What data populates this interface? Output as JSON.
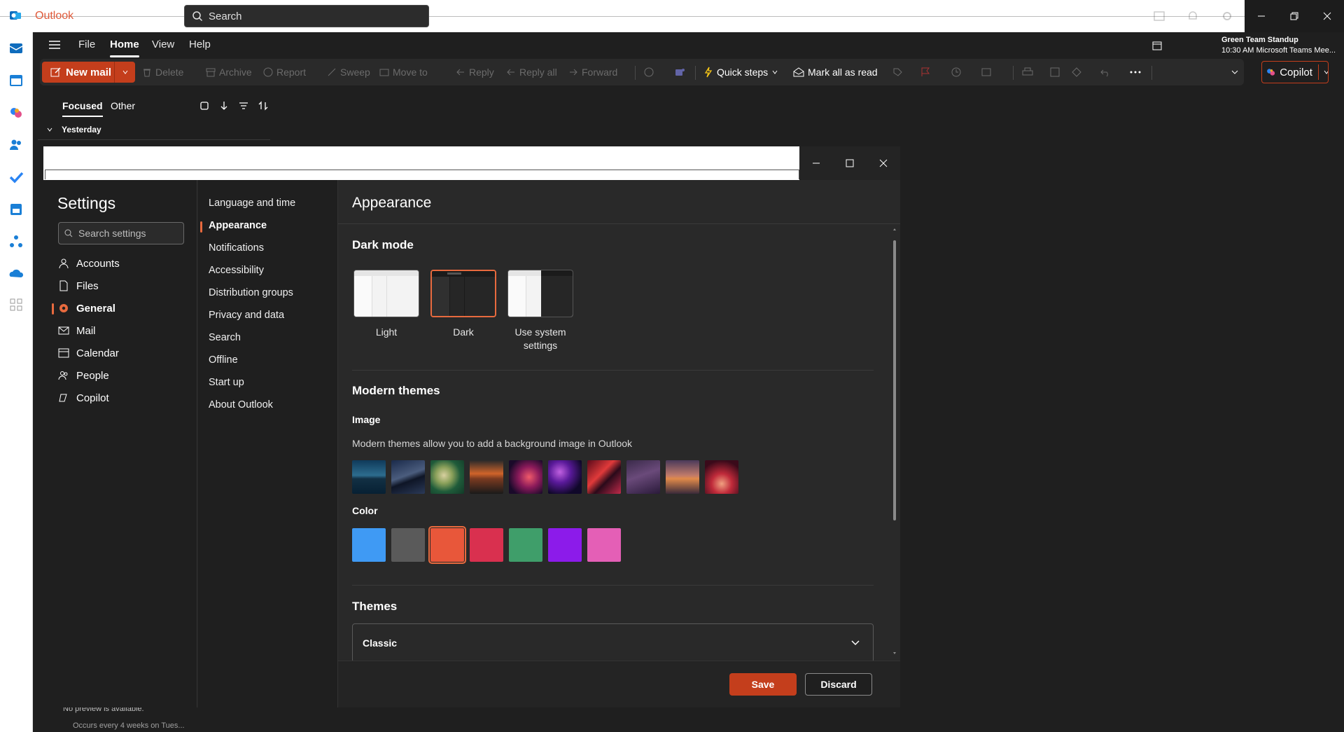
{
  "app": {
    "name": "Outlook"
  },
  "titlebar": {
    "search_placeholder": "Search"
  },
  "menu": {
    "items": [
      "File",
      "Home",
      "View",
      "Help"
    ],
    "active": "Home"
  },
  "meeting": {
    "title": "Green Team Standup",
    "detail": "10:30 AM Microsoft Teams Mee..."
  },
  "toolbar": {
    "new_mail": "New mail",
    "delete": "Delete",
    "archive": "Archive",
    "report": "Report",
    "sweep": "Sweep",
    "move_to": "Move to",
    "reply": "Reply",
    "reply_all": "Reply all",
    "forward": "Forward",
    "quick_steps": "Quick steps",
    "mark_all_read": "Mark all as read",
    "copilot": "Copilot"
  },
  "mail_list": {
    "tab_focused": "Focused",
    "tab_other": "Other",
    "group": "Yesterday",
    "preview": "No preview is available.",
    "occurs": "Occurs every 4 weeks on Tues..."
  },
  "settings": {
    "title": "Settings",
    "search_placeholder": "Search settings",
    "categories": [
      {
        "label": "Accounts",
        "icon": "person-icon"
      },
      {
        "label": "Files",
        "icon": "file-icon"
      },
      {
        "label": "General",
        "icon": "gear-icon"
      },
      {
        "label": "Mail",
        "icon": "mail-icon"
      },
      {
        "label": "Calendar",
        "icon": "calendar-icon"
      },
      {
        "label": "People",
        "icon": "people-icon"
      },
      {
        "label": "Copilot",
        "icon": "copilot-icon"
      }
    ],
    "active_category": "General",
    "subcategories": [
      "Language and time",
      "Appearance",
      "Notifications",
      "Accessibility",
      "Distribution groups",
      "Privacy and data",
      "Search",
      "Offline",
      "Start up",
      "About Outlook"
    ],
    "active_subcategory": "Appearance",
    "content": {
      "title": "Appearance",
      "dark_mode": {
        "heading": "Dark mode",
        "options": [
          "Light",
          "Dark",
          "Use system settings"
        ],
        "selected": "Dark"
      },
      "modern_themes": {
        "heading": "Modern themes",
        "image_heading": "Image",
        "image_description": "Modern themes allow you to add a background image in Outlook",
        "color_heading": "Color",
        "colors": [
          "#3f9af4",
          "#5a5a5a",
          "#e8573a",
          "#d9304f",
          "#3f9e6a",
          "#8c1bea",
          "#e45fb6"
        ],
        "selected_color": "#e8573a"
      },
      "themes": {
        "heading": "Themes",
        "selected": "Classic"
      },
      "save": "Save",
      "discard": "Discard"
    }
  }
}
